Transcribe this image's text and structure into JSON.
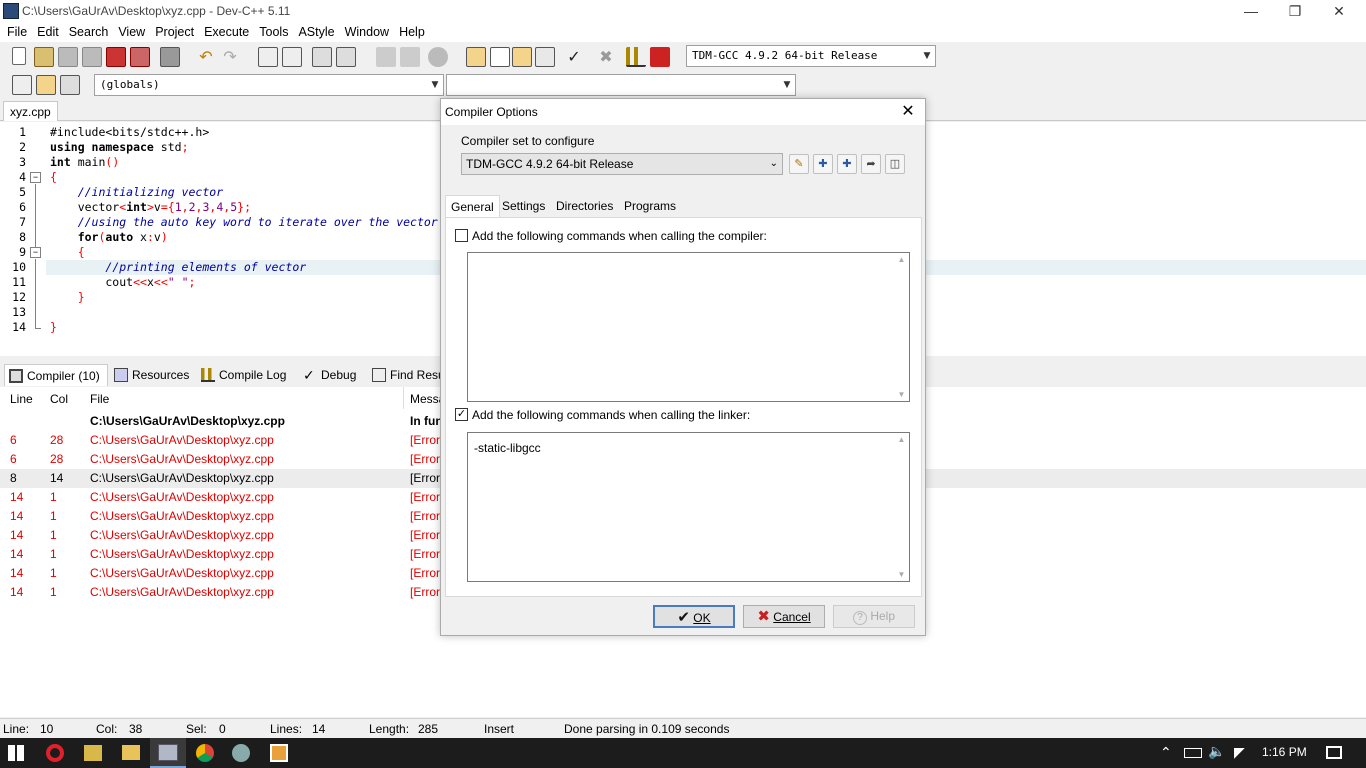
{
  "window": {
    "title": "C:\\Users\\GaUrAv\\Desktop\\xyz.cpp - Dev-C++ 5.11",
    "app_icon": "devcpp-icon",
    "controls": [
      "minimize",
      "maximize",
      "close"
    ]
  },
  "menu": [
    "File",
    "Edit",
    "Search",
    "View",
    "Project",
    "Execute",
    "Tools",
    "AStyle",
    "Window",
    "Help"
  ],
  "toolbar": {
    "compiler_select": "TDM-GCC 4.9.2 64-bit Release",
    "globals_select": "(globals)",
    "function_select": ""
  },
  "file_tab": "xyz.cpp",
  "editor": {
    "line_numbers": [
      "1",
      "2",
      "3",
      "4",
      "5",
      "6",
      "7",
      "8",
      "9",
      "10",
      "11",
      "12",
      "13",
      "14"
    ],
    "highlight_line": 10
  },
  "bottom_tabs": [
    "Compiler (10)",
    "Resources",
    "Compile Log",
    "Debug",
    "Find Resu"
  ],
  "messages": {
    "columns": [
      "Line",
      "Col",
      "File",
      "Messa"
    ],
    "header_row": {
      "file": "C:\\Users\\GaUrAv\\Desktop\\xyz.cpp",
      "msg": "In fun"
    },
    "rows": [
      {
        "line": "6",
        "col": "28",
        "file": "C:\\Users\\GaUrAv\\Desktop\\xyz.cpp",
        "msg": "[Error",
        "error": true
      },
      {
        "line": "6",
        "col": "28",
        "file": "C:\\Users\\GaUrAv\\Desktop\\xyz.cpp",
        "msg": "[Error",
        "error": true
      },
      {
        "line": "8",
        "col": "14",
        "file": "C:\\Users\\GaUrAv\\Desktop\\xyz.cpp",
        "msg": "[Error",
        "error": false
      },
      {
        "line": "14",
        "col": "1",
        "file": "C:\\Users\\GaUrAv\\Desktop\\xyz.cpp",
        "msg": "[Error",
        "error": true
      },
      {
        "line": "14",
        "col": "1",
        "file": "C:\\Users\\GaUrAv\\Desktop\\xyz.cpp",
        "msg": "[Error",
        "error": true
      },
      {
        "line": "14",
        "col": "1",
        "file": "C:\\Users\\GaUrAv\\Desktop\\xyz.cpp",
        "msg": "[Error",
        "error": true
      },
      {
        "line": "14",
        "col": "1",
        "file": "C:\\Users\\GaUrAv\\Desktop\\xyz.cpp",
        "msg": "[Error",
        "error": true
      },
      {
        "line": "14",
        "col": "1",
        "file": "C:\\Users\\GaUrAv\\Desktop\\xyz.cpp",
        "msg": "[Error",
        "error": true
      },
      {
        "line": "14",
        "col": "1",
        "file": "C:\\Users\\GaUrAv\\Desktop\\xyz.cpp",
        "msg": "[Error",
        "error": true
      }
    ]
  },
  "status": {
    "line_label": "Line:",
    "line": "10",
    "col_label": "Col:",
    "col": "38",
    "sel_label": "Sel:",
    "sel": "0",
    "lines_label": "Lines:",
    "lines": "14",
    "length_label": "Length:",
    "length": "285",
    "mode": "Insert",
    "message": "Done parsing in 0.109 seconds"
  },
  "dialog": {
    "title": "Compiler Options",
    "compiler_set_label": "Compiler set to configure",
    "compiler_set_value": "TDM-GCC 4.9.2 64-bit Release",
    "tabs": [
      "General",
      "Settings",
      "Directories",
      "Programs"
    ],
    "compiler_cmd_label": "Add the following commands when calling the compiler:",
    "compiler_cmd_checked": false,
    "compiler_cmd_value": "",
    "linker_cmd_label": "Add the following commands when calling the linker:",
    "linker_cmd_checked": true,
    "linker_cmd_value": "-static-libgcc",
    "ok_label": "OK",
    "cancel_label": "Cancel",
    "help_label": "Help"
  },
  "taskbar": {
    "time": "1:16 PM"
  },
  "colors": {
    "error_text": "#e00000",
    "comment": "#0000a0",
    "symbol": "#ff0000",
    "number": "#800080",
    "highlight_line": "#e8f2f5"
  }
}
